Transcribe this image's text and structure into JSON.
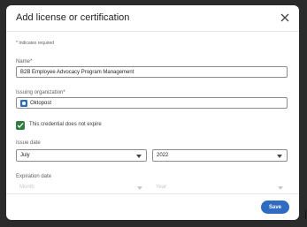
{
  "modal": {
    "title": "Add license or certification",
    "required_note": "* Indicates required",
    "name_label": "Name*",
    "name_value": "B2B Employee Advocacy Program Management",
    "org_label": "Issuing organization*",
    "org_value": "Oktopost",
    "no_expire_label": "This credential does not expire",
    "issue_label": "Issue date",
    "issue_month": "July",
    "issue_year": "2022",
    "exp_label": "Expiration date",
    "exp_month": "Month",
    "exp_year": "Year",
    "save_label": "Save",
    "colors": {
      "accent": "#2d6cc0",
      "check": "#2f7d3f"
    },
    "icons": {
      "close": "close-icon",
      "check": "checkmark-icon",
      "org": "company-logo-icon",
      "dropdown": "chevron-down-icon"
    }
  }
}
